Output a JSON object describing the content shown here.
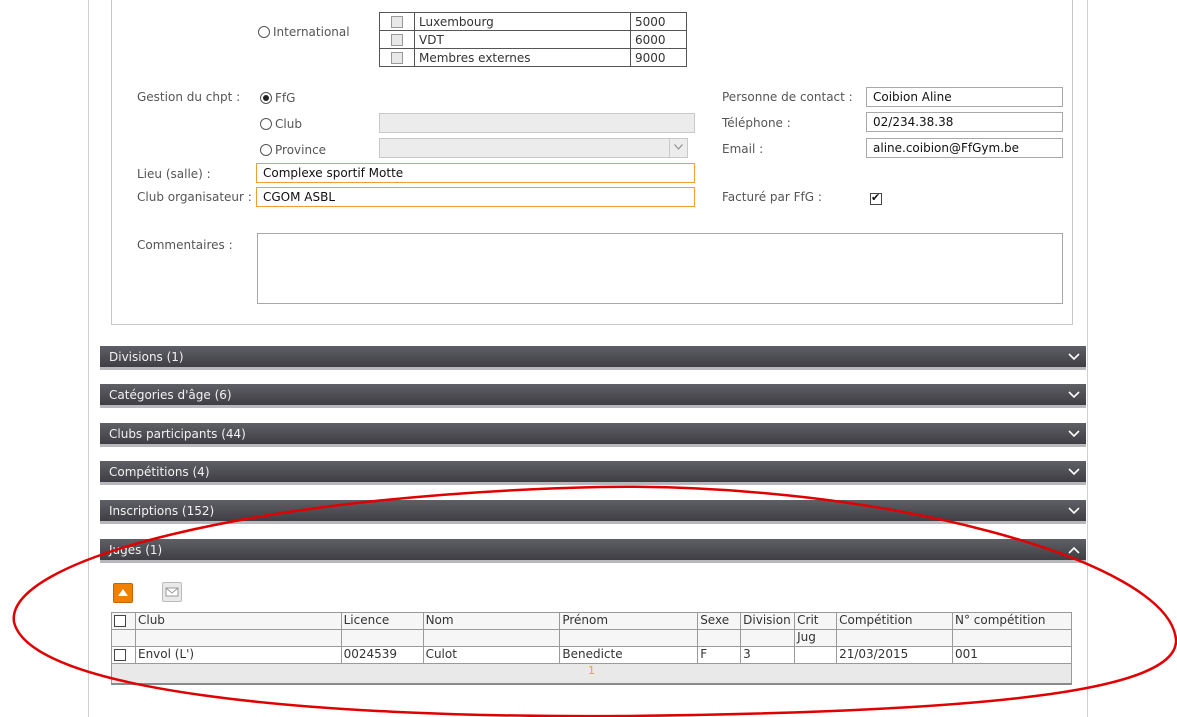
{
  "region_options": {
    "international_label": "International",
    "rows": [
      {
        "name": "Luxembourg",
        "code": "5000"
      },
      {
        "name": "VDT",
        "code": "6000"
      },
      {
        "name": "Membres externes",
        "code": "9000"
      }
    ]
  },
  "form": {
    "gestion_label": "Gestion du chpt :",
    "radio_ffg": "FfG",
    "radio_club": "Club",
    "radio_province": "Province",
    "club_value": "",
    "province_value": "",
    "lieu_label": "Lieu (salle) :",
    "lieu_value": "Complexe sportif Motte",
    "club_org_label": "Club organisateur :",
    "club_org_value": "CGOM ASBL",
    "commentaires_label": "Commentaires :",
    "commentaires_value": "",
    "contact_label": "Personne de contact :",
    "contact_value": "Coibion Aline",
    "telephone_label": "Téléphone :",
    "telephone_value": "02/234.38.38",
    "email_label": "Email :",
    "email_value": "aline.coibion@FfGym.be",
    "facture_label": "Facturé par FfG :",
    "facture_checked": true
  },
  "sections": [
    {
      "label": "Divisions (1)",
      "state": "collapsed"
    },
    {
      "label": "Catégories d'âge (6)",
      "state": "collapsed"
    },
    {
      "label": "Clubs participants (44)",
      "state": "collapsed"
    },
    {
      "label": "Compétitions (4)",
      "state": "collapsed"
    },
    {
      "label": "Inscriptions (152)",
      "state": "collapsed"
    },
    {
      "label": "Juges (1)",
      "state": "expanded"
    }
  ],
  "judges_table": {
    "headers": [
      "Club",
      "Licence",
      "Nom",
      "Prénom",
      "Sexe",
      "Division",
      "Crit",
      "Compétition",
      "N° compétition"
    ],
    "header_second_line": {
      "crit": "Jug"
    },
    "rows": [
      {
        "club": "Envol (L')",
        "licence": "0024539",
        "nom": "Culot",
        "prenom": "Benedicte",
        "sexe": "F",
        "division": "3",
        "crit": "",
        "competition": "21/03/2015",
        "num_competition": "001"
      }
    ],
    "pager_current": "1"
  },
  "colors": {
    "section_bar": "#4e4e55",
    "accent_orange": "#f08000",
    "annotation_red": "#e00000"
  }
}
